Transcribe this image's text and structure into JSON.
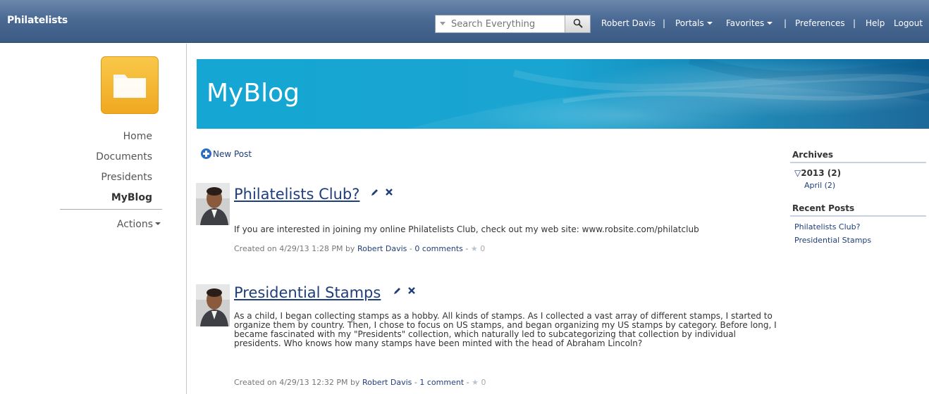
{
  "app": {
    "title": "Philatelists"
  },
  "search": {
    "placeholder": "Search Everything"
  },
  "topnav": {
    "user": "Robert Davis",
    "portals": "Portals",
    "favorites": "Favorites",
    "preferences": "Preferences",
    "help": "Help",
    "logout": "Logout"
  },
  "leftnav": {
    "items": [
      {
        "label": "Home"
      },
      {
        "label": "Documents"
      },
      {
        "label": "Presidents"
      },
      {
        "label": "MyBlog"
      }
    ],
    "actions": "Actions"
  },
  "banner": {
    "title": "MyBlog"
  },
  "content": {
    "new_post": "New Post"
  },
  "posts": [
    {
      "title": "Philatelists Club?",
      "body": "If you are interested in joining my online Philatelists Club, check out my web site: www.robsite.com/philatclub",
      "created": "Created on 4/29/13 1:28 PM by ",
      "author": "Robert Davis",
      "comments": "0 comments",
      "rating": "0"
    },
    {
      "title": "Presidential Stamps",
      "body": "As a child, I began collecting stamps as a hobby. All kinds of stamps. As I collected a vast array of different stamps, I started to organize them by country. Then, I chose to focus on US stamps, and began organizing my US stamps by category. Before long, I became fascinated with my \"Presidents\" collection, which naturally led to subcategorizing that collection by individual presidents. Who knows how many stamps have been minted with the head of Abraham Lincoln?",
      "created": "Created on 4/29/13 12:32 PM by ",
      "author": "Robert Davis",
      "comments": "1 comment",
      "rating": "0"
    }
  ],
  "sidebar": {
    "archives_title": "Archives",
    "year": "2013 (2)",
    "month": "April (2)",
    "recent_title": "Recent Posts",
    "recent": [
      "Philatelists Club?",
      "Presidential Stamps"
    ]
  },
  "colors": {
    "topbar": "#4a6a94",
    "link": "#1f3e7a",
    "banner": "#15a6d3",
    "folder": "#f0a820"
  }
}
